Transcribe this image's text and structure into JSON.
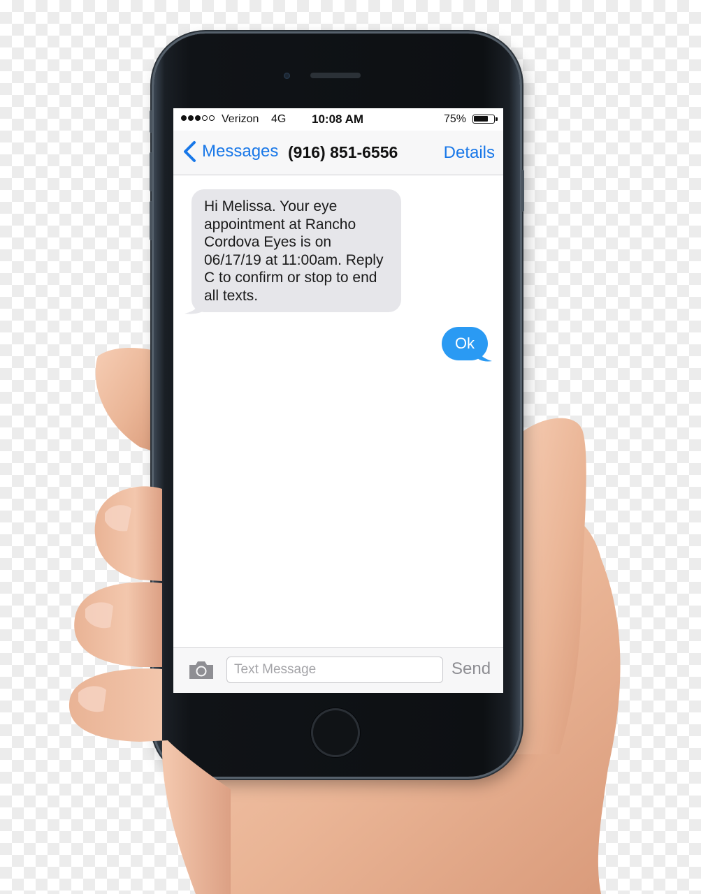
{
  "status_bar": {
    "signal_bars": 5,
    "signal_filled": 3,
    "carrier": "Verizon",
    "network": "4G",
    "time": "10:08 AM",
    "battery_percent": "75%",
    "battery_level": 0.75
  },
  "nav": {
    "back_label": "Messages",
    "title": "(916) 851-6556",
    "details_label": "Details"
  },
  "messages": [
    {
      "direction": "incoming",
      "text": "Hi Melissa. Your eye appointment at Rancho Cordova Eyes is on 06/17/19 at 11:00am. Reply C to confirm or stop to end all texts."
    },
    {
      "direction": "outgoing",
      "text": "Ok"
    }
  ],
  "composer": {
    "camera_icon": "camera-icon",
    "placeholder": "Text Message",
    "value": "",
    "send_label": "Send"
  },
  "colors": {
    "accent": "#1877e8",
    "outgoing_bubble": "#2a9af3",
    "incoming_bubble": "#e6e6ea",
    "send_inactive": "#8d8d92"
  }
}
